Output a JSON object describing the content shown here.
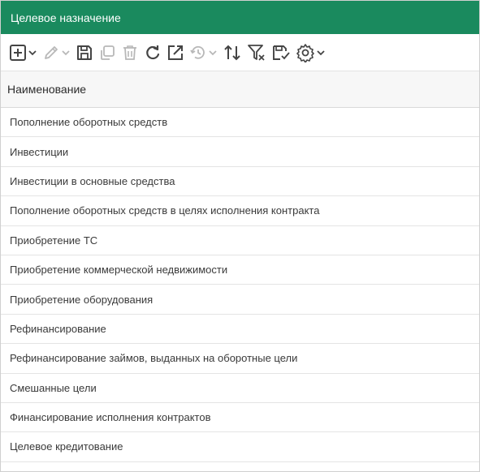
{
  "panel": {
    "title": "Целевое назначение"
  },
  "toolbar": {
    "icons": [
      "add-icon",
      "edit-icon",
      "save-icon",
      "copy-icon",
      "delete-icon",
      "refresh-icon",
      "open-external-icon",
      "history-icon",
      "sort-icon",
      "filter-clear-icon",
      "save-settings-icon",
      "settings-icon"
    ]
  },
  "table": {
    "column_header": "Наименование",
    "rows": [
      "Пополнение оборотных средств",
      "Инвестиции",
      "Инвестиции в основные средства",
      "Пополнение оборотных средств в целях исполнения контракта",
      "Приобретение ТС",
      "Приобретение коммерческой недвижимости",
      "Приобретение оборудования",
      "Рефинансирование",
      "Рефинансирование займов, выданных на оборотные цели",
      "Смешанные цели",
      "Финансирование исполнения контрактов",
      "Целевое кредитование"
    ]
  },
  "colors": {
    "title_bar": "#1a8a5e",
    "icon_active": "#444444",
    "icon_disabled": "#b8b8b8"
  }
}
